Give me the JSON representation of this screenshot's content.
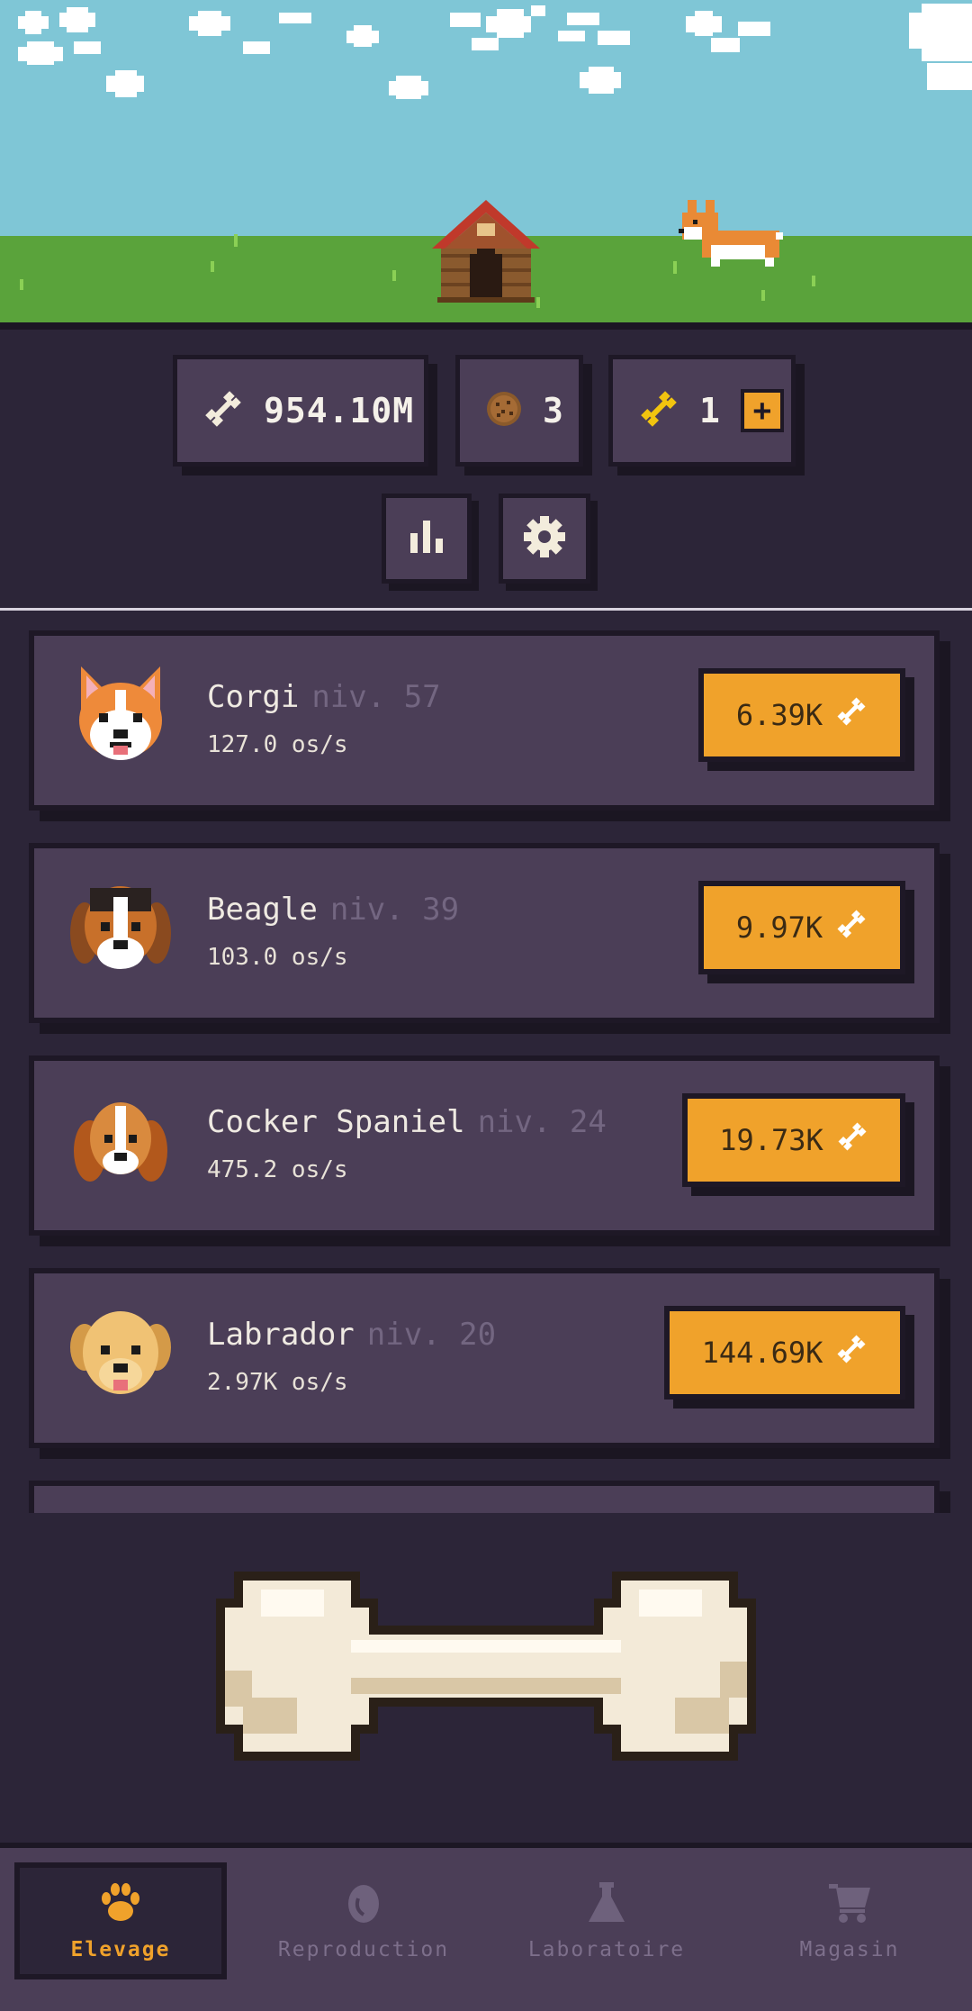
{
  "currencies": {
    "bones": "954.10M",
    "cookies": "3",
    "golden_bones": "1",
    "golden_plus": "+"
  },
  "dogs": [
    {
      "name": "Corgi",
      "level": "niv. 57",
      "rate": "127.0 os/s",
      "price": "6.39K"
    },
    {
      "name": "Beagle",
      "level": "niv. 39",
      "rate": "103.0 os/s",
      "price": "9.97K"
    },
    {
      "name": "Cocker Spaniel",
      "level": "niv. 24",
      "rate": "475.2 os/s",
      "price": "19.73K"
    },
    {
      "name": "Labrador",
      "level": "niv. 20",
      "rate": "2.97K os/s",
      "price": "144.69K"
    }
  ],
  "nav": {
    "tabs": [
      {
        "label": "Elevage",
        "icon": "paw-icon",
        "active": true
      },
      {
        "label": "Reproduction",
        "icon": "egg-icon",
        "active": false
      },
      {
        "label": "Laboratoire",
        "icon": "flask-icon",
        "active": false
      },
      {
        "label": "Magasin",
        "icon": "cart-icon",
        "active": false
      }
    ]
  },
  "colors": {
    "accent": "#f0a22b",
    "panel": "#4b3e57",
    "background": "#2c2538",
    "sky": "#7fc6d6",
    "grass": "#5aa33b"
  }
}
